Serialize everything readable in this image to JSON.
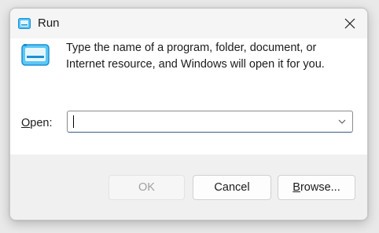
{
  "window": {
    "title": "Run"
  },
  "dialog": {
    "message_line1": "Type the name of a program, folder, document, or",
    "message_line2": "Internet resource, and Windows will open it for you."
  },
  "open_field": {
    "label_accel": "O",
    "label_rest": "pen:",
    "value": ""
  },
  "buttons": {
    "ok_label": "OK",
    "cancel_label": "Cancel",
    "browse_accel": "B",
    "browse_rest": "rowse..."
  },
  "colors": {
    "accent": "#3c5a86",
    "icon_blue": "#1e8fd6",
    "disabled_text": "#a0a0a0"
  },
  "icons": {
    "app": "run-app-icon",
    "dialog": "run-app-icon",
    "close": "close-icon",
    "dropdown": "chevron-down-icon"
  }
}
